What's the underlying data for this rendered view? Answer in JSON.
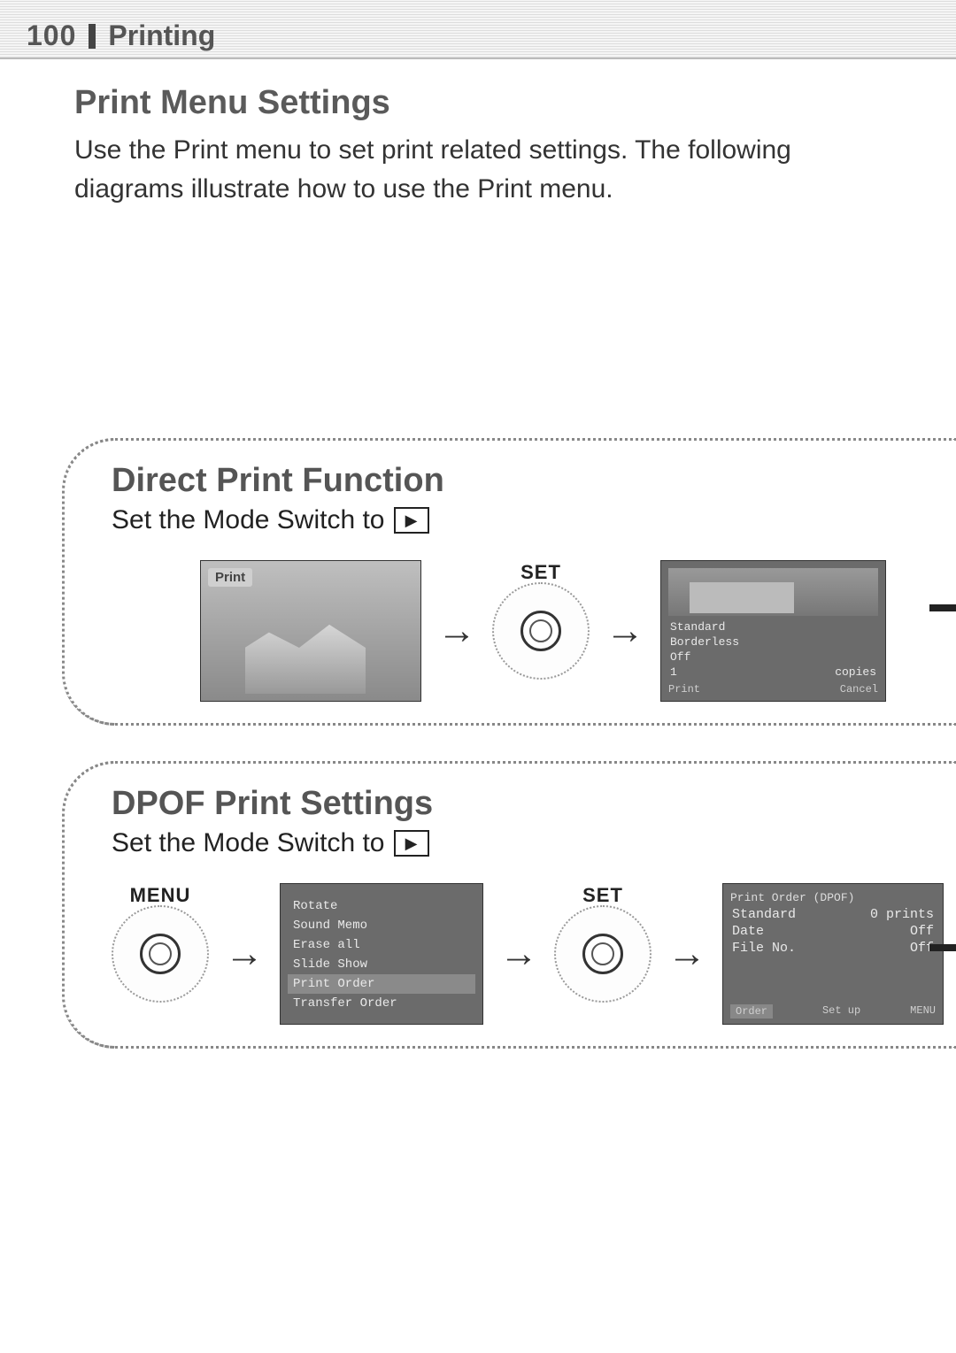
{
  "header": {
    "page_number": "100",
    "chapter": "Printing"
  },
  "section": {
    "title": "Print Menu Settings",
    "intro": "Use the Print menu to set print related settings. The following diagrams illustrate how to use the Print menu."
  },
  "panel_direct": {
    "title": "Direct Print Function",
    "subtitle_prefix": "Set the Mode Switch to",
    "play_icon": "▶",
    "thumb_tag": "Print",
    "set_label": "SET",
    "detail": {
      "opt1": "Standard",
      "opt2": "Borderless",
      "opt3": "Off",
      "copies_label": "copies",
      "copies_value": "1",
      "footer_left": "Print",
      "footer_right": "Cancel"
    }
  },
  "panel_dpof": {
    "title": "DPOF Print Settings",
    "subtitle_prefix": "Set the Mode Switch to",
    "play_icon": "▶",
    "menu_label": "MENU",
    "set_label": "SET",
    "menu_items": {
      "i0": "Rotate",
      "i1": "Sound Memo",
      "i2": "Erase all",
      "i3": "Slide Show",
      "i4": "Print Order",
      "i5": "Transfer Order"
    },
    "order": {
      "title": "Print Order (DPOF)",
      "row1_l": "Standard",
      "row1_r": "0 prints",
      "row2_l": "Date",
      "row2_r": "Off",
      "row3_l": "File No.",
      "row3_r": "Off",
      "footer_l": "Order",
      "footer_m": "Set up",
      "footer_r": "MENU"
    }
  }
}
